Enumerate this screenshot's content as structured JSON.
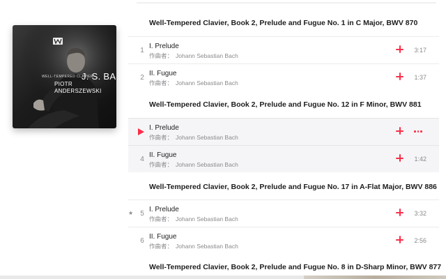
{
  "album": {
    "cover": {
      "series": "WELL-TEMPERED CLAVIER",
      "composer": "J. S. BACH",
      "artist_line1": "PIOTR",
      "artist_line2": "ANDERSZEWSKI",
      "label_logo": "warner-classics-logo"
    }
  },
  "sections": [
    {
      "title": "Well-Tempered Clavier, Book 2, Prelude and Fugue No. 1 in C Major, BWV 870",
      "tracks": [
        {
          "number": "1",
          "title": "I. Prelude",
          "composer_label": "作曲者：",
          "composer": "Johann Sebastian Bach",
          "duration": "3:17"
        },
        {
          "number": "2",
          "title": "II. Fugue",
          "composer_label": "作曲者：",
          "composer": "Johann Sebastian Bach",
          "duration": "1:37"
        }
      ]
    },
    {
      "title": "Well-Tempered Clavier, Book 2, Prelude and Fugue No. 12 in F Minor, BWV 881",
      "tracks": [
        {
          "number": "",
          "title": "I. Prelude",
          "composer_label": "作曲者：",
          "composer": "Johann Sebastian Bach",
          "duration": ""
        },
        {
          "number": "4",
          "title": "II. Fugue",
          "composer_label": "作曲者：",
          "composer": "Johann Sebastian Bach",
          "duration": "1:42"
        }
      ]
    },
    {
      "title": "Well-Tempered Clavier, Book 2, Prelude and Fugue No. 17 in A-Flat Major, BWV 886",
      "tracks": [
        {
          "number": "5",
          "title": "I. Prelude",
          "composer_label": "作曲者：",
          "composer": "Johann Sebastian Bach",
          "duration": "3:32",
          "star": "★"
        },
        {
          "number": "6",
          "title": "II. Fugue",
          "composer_label": "作曲者：",
          "composer": "Johann Sebastian Bach",
          "duration": "2:56"
        }
      ]
    },
    {
      "title": "Well-Tempered Clavier, Book 2, Prelude and Fugue No. 8 in D-Sharp Minor, BWV 877",
      "tracks": []
    }
  ],
  "icons": {
    "play": "play-icon",
    "add": "plus-icon",
    "more": "more-icon",
    "favorite": "star-icon"
  },
  "colors": {
    "accent": "#fa2d48",
    "secondary_text": "#8a8a8e",
    "primary_text": "#1d1d1f",
    "active_row": "#f5f5f7"
  }
}
